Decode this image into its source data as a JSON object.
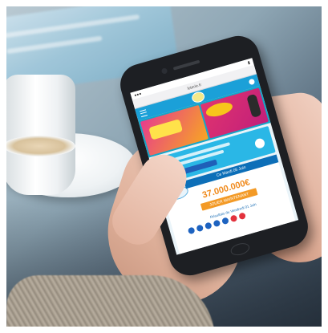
{
  "browser": {
    "url": "loterie.fr"
  },
  "site": {
    "banners": [
      "game-banner-1",
      "game-banner-2"
    ]
  },
  "draw": {
    "date_label": "Ce Mardi 05 Juin",
    "jackpot": "37.000.000€",
    "play_label": "JOUER MAINTENANT",
    "results_label": "Résultats du Vendredi 01 Juin"
  },
  "colors": {
    "site_blue": "#1ba0d8",
    "jackpot_orange": "#f08a1c",
    "ball_blue": "#1e63c0",
    "ball_red": "#e2313c"
  }
}
